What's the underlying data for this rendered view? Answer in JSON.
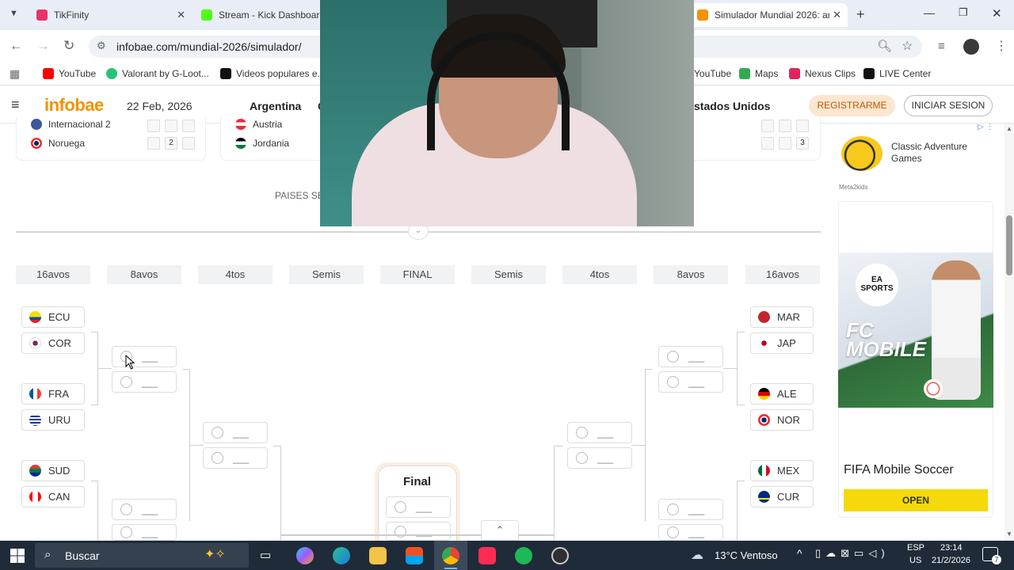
{
  "tabs": [
    {
      "title": "TikFinity"
    },
    {
      "title": "Stream - Kick Dashboard"
    },
    {
      "title": "Simulador Mundial 2026: ar"
    }
  ],
  "address": {
    "url": "infobae.com/mundial-2026/simulador/"
  },
  "bookmarks": [
    "YouTube",
    "Valorant by G-Loot...",
    "Videos populares e...",
    "YouTube",
    "Maps",
    "Nexus Clips",
    "LIVE Center"
  ],
  "site": {
    "logo": "infobae",
    "date": "22 Feb, 2026",
    "nav": [
      "Argentina",
      "C",
      "stados Unidos"
    ],
    "register": "REGISTRARME",
    "login": "INICIAR SESION"
  },
  "groups": {
    "card1": {
      "rows": [
        {
          "name": "Internacional 2"
        },
        {
          "name": "Noruega",
          "score": "2"
        }
      ]
    },
    "card2": {
      "rows": [
        {
          "name": "Austria"
        },
        {
          "name": "Jordania"
        }
      ]
    },
    "card3": {
      "score": "3"
    },
    "caption": "PAISES SE"
  },
  "stages": [
    "16avos",
    "8avos",
    "4tos",
    "Semis",
    "FINAL",
    "Semis",
    "4tos",
    "8avos",
    "16avos"
  ],
  "bracket": {
    "left_teams": [
      "ECU",
      "COR",
      "FRA",
      "URU",
      "SUD",
      "CAN"
    ],
    "right_teams": [
      "MAR",
      "JAP",
      "ALE",
      "NOR",
      "MEX",
      "CUR"
    ],
    "placeholder": "___",
    "final_title": "Final"
  },
  "ad": {
    "small_title": "Classic Adventure Games",
    "small_source": "Meta2kids",
    "ea_sports": "EA SPORTS",
    "fc_mobile": "FC MOBILE",
    "big_title": "FIFA Mobile Soccer",
    "cta": "OPEN"
  },
  "taskbar": {
    "search": "Buscar",
    "weather": "13°C Ventoso",
    "lang": "ESP",
    "region": "US",
    "time": "23:14",
    "date": "21/2/2026",
    "notifications": "7"
  },
  "colors": {
    "brand": "#f39200",
    "taskbar": "#1f2b38",
    "cta": "#f5d90a"
  }
}
